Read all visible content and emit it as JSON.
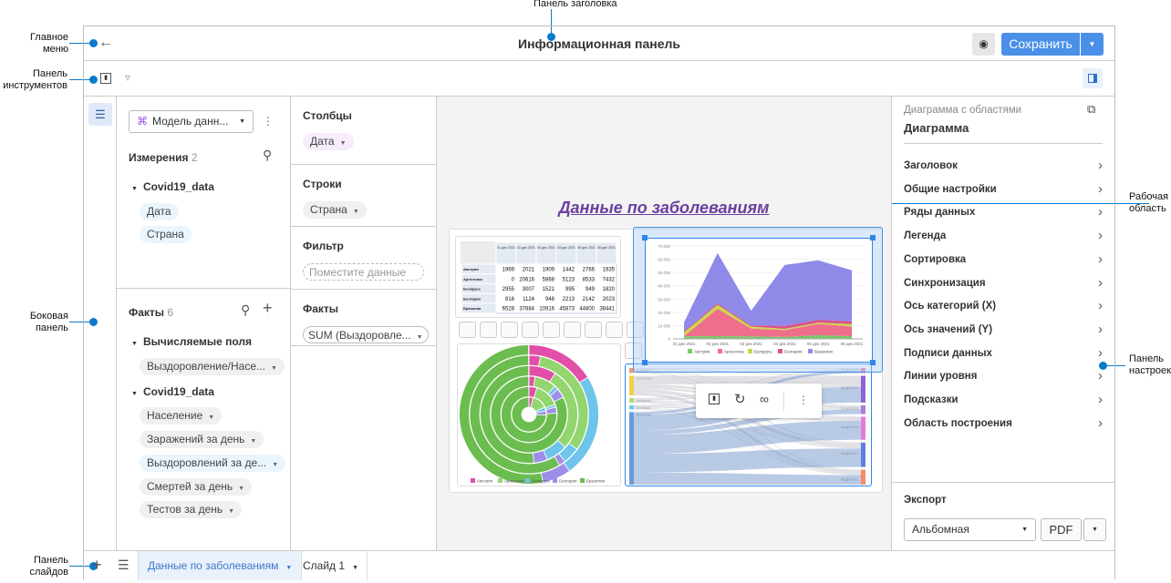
{
  "annotations": {
    "title_panel": "Панель заголовка",
    "main_menu": "Главное меню",
    "toolbar": "Панель инструментов",
    "side_panel": "Боковая панель",
    "slides_panel": "Панель слайдов",
    "work_area": "Рабочая область",
    "settings_panel": "Панель настроек"
  },
  "header": {
    "title": "Информационная панель",
    "save_label": "Сохранить"
  },
  "data_panel": {
    "model_label": "Модель данн...",
    "dimensions_label": "Измерения",
    "dimensions_count": "2",
    "dim_group": "Covid19_data",
    "dims": [
      "Дата",
      "Страна"
    ],
    "facts_label": "Факты",
    "facts_count": "6",
    "calc_group": "Вычисляемые поля",
    "calc_fields": [
      "Выздоровление/Насе..."
    ],
    "fact_group": "Covid19_data",
    "facts": [
      "Население",
      "Заражений за день",
      "Выздоровлений за де...",
      "Смертей за день",
      "Тестов за день"
    ]
  },
  "wells": {
    "columns_label": "Столбцы",
    "columns_chip": "Дата",
    "rows_label": "Строки",
    "rows_chip": "Страна",
    "filter_label": "Фильтр",
    "filter_placeholder": "Поместите данные",
    "facts_label": "Факты",
    "facts_chip": "SUM (Выздоровле..."
  },
  "work": {
    "dashboard_title": "Данные по заболеваниям"
  },
  "settings": {
    "subtitle": "Диаграмма с областями",
    "title": "Диаграмма",
    "items": [
      "Заголовок",
      "Общие настройки",
      "Ряды данных",
      "Легенда",
      "Сортировка",
      "Синхронизация",
      "Ось категорий (X)",
      "Ось значений (Y)",
      "Подписи данных",
      "Линии уровня",
      "Подсказки",
      "Область построения"
    ],
    "export_label": "Экспорт",
    "orientation": "Альбомная",
    "format": "PDF"
  },
  "footer": {
    "slides": [
      "Данные по заболеваниям",
      "Слайд 1"
    ]
  },
  "chart_data": [
    {
      "type": "table",
      "columns": [
        "01 дек 2021",
        "02 дек 2021",
        "03 дек 2021",
        "04 дек 2021",
        "05 дек 2021",
        "06 дек 2021"
      ],
      "rows": [
        {
          "name": "Австрия",
          "values": [
            1969,
            2021,
            1909,
            1442,
            2766,
            1935
          ]
        },
        {
          "name": "Аргентина",
          "values": [
            0,
            20616,
            5868,
            5123,
            8533,
            7432
          ]
        },
        {
          "name": "Беларусь",
          "values": [
            2955,
            3007,
            1521,
            995,
            949,
            1820
          ]
        },
        {
          "name": "Болгария",
          "values": [
            816,
            1124,
            948,
            2213,
            2142,
            2023
          ]
        },
        {
          "name": "Бразилия",
          "values": [
            6528,
            37884,
            10916,
            45873,
            44800,
            38441
          ]
        }
      ]
    },
    {
      "type": "area",
      "stacked": true,
      "categories": [
        "01 дек 2021",
        "02 дек 2021",
        "03 дек 2021",
        "04 дек 2021",
        "05 дек 2021",
        "06 дек 2021"
      ],
      "ylim": [
        0,
        70000
      ],
      "yticks": [
        "0",
        "10 000",
        "20 000",
        "30 000",
        "40 000",
        "50 000",
        "60 000",
        "70 000"
      ],
      "legend": "bottom",
      "series": [
        {
          "name": "Австрия",
          "color": "#79c86b",
          "values": [
            1969,
            2021,
            1909,
            1442,
            2766,
            1935
          ]
        },
        {
          "name": "Аргентина",
          "color": "#ef6e8b",
          "values": [
            0,
            20616,
            5868,
            5123,
            8533,
            7432
          ]
        },
        {
          "name": "Беларусь",
          "color": "#c9d84a",
          "values": [
            2955,
            3007,
            1521,
            995,
            949,
            1820
          ]
        },
        {
          "name": "Болгария",
          "color": "#d9528d",
          "values": [
            816,
            1124,
            948,
            2213,
            2142,
            2023
          ]
        },
        {
          "name": "Бразилия",
          "color": "#8f89e8",
          "values": [
            6528,
            37884,
            10916,
            45873,
            44800,
            38441
          ]
        }
      ]
    },
    {
      "type": "pie",
      "variant": "sunburst",
      "legend": "bottom",
      "series": [
        {
          "name": "Австрия",
          "color": "#e24fa8"
        },
        {
          "name": "Аргентина",
          "color": "#93d56e"
        },
        {
          "name": "Беларусь",
          "color": "#6ec4ea"
        },
        {
          "name": "Болгария",
          "color": "#9d8fe8"
        },
        {
          "name": "Бразилия",
          "color": "#6cbd50"
        }
      ]
    }
  ]
}
